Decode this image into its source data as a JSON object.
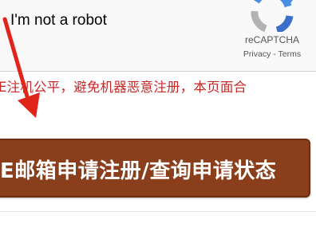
{
  "captcha": {
    "label": "I'm not a robot",
    "brand": "reCAPTCHA",
    "privacy_link": "Privacy",
    "separator": " - ",
    "terms_link": "Terms",
    "logo_icon": "recaptcha-logo-icon",
    "colors": {
      "logo_blue": "#4a90e2",
      "logo_grey": "#b3b3b3",
      "text": "#555555"
    }
  },
  "notice": {
    "text": "E注机公平，避免机器恶意注册，本页面合"
  },
  "register": {
    "label": "E邮箱申请注册/查询申请状态",
    "colors": {
      "background": "#8a3e1b",
      "text": "#ffffff"
    }
  },
  "annotation": {
    "icon": "red-arrow-icon",
    "color": "#e0251b"
  }
}
